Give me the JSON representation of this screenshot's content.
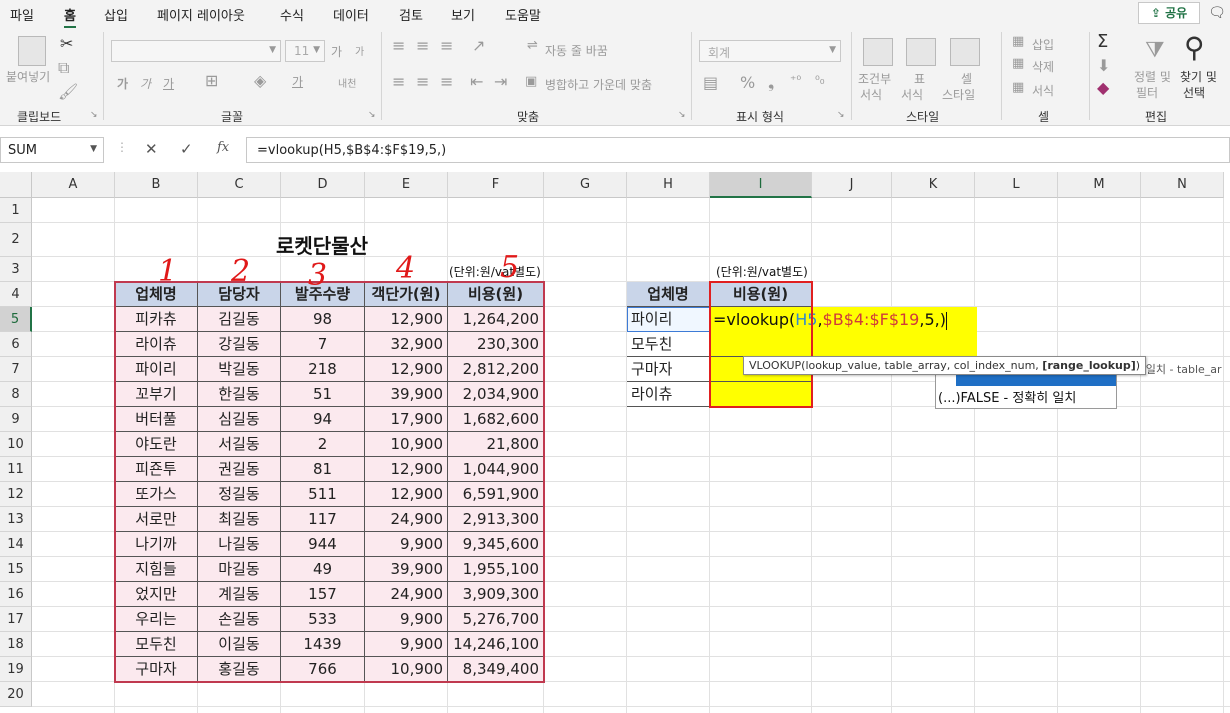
{
  "menu": {
    "items": [
      "파일",
      "홈",
      "삽입",
      "페이지 레이아웃",
      "수식",
      "데이터",
      "검토",
      "보기",
      "도움말"
    ],
    "share_label": "공유",
    "share_icon": "share-icon",
    "comment_icon": "comment-icon"
  },
  "ribbon": {
    "clipboard": {
      "paste": "붙여넣기",
      "label": "클립보드"
    },
    "font": {
      "size": "11",
      "label": "글꼴",
      "grow": "가",
      "shrink": "가"
    },
    "align": {
      "wrap": "자동 줄 바꿈",
      "merge": "병합하고 가운데 맞춤",
      "label": "맞춤"
    },
    "number": {
      "format": "회계",
      "label": "표시 형식"
    },
    "styles": {
      "conditional_1": "조건부",
      "conditional_2": "서식",
      "table_1": "표",
      "table_2": "서식",
      "cell_1": "셀",
      "cell_2": "스타일",
      "label": "스타일"
    },
    "cells": {
      "insert": "삽입",
      "delete": "삭제",
      "format": "서식",
      "label": "셀"
    },
    "edit": {
      "sort_1": "정렬 및",
      "sort_2": "필터",
      "find_1": "찾기 및",
      "find_2": "선택",
      "label": "편집"
    }
  },
  "formula_bar": {
    "name_box": "SUM",
    "formula": "=vlookup(H5,$B$4:$F$19,5,)",
    "cancel_icon": "cancel-icon",
    "enter_icon": "enter-icon",
    "fx": "fx"
  },
  "sheet": {
    "columns": [
      "A",
      "B",
      "C",
      "D",
      "E",
      "F",
      "G",
      "H",
      "I",
      "J",
      "K",
      "L",
      "M",
      "N"
    ],
    "rows": [
      "1",
      "2",
      "3",
      "4",
      "5",
      "6",
      "7",
      "8",
      "9",
      "10",
      "11",
      "12",
      "13",
      "14",
      "15",
      "16",
      "17",
      "18",
      "19",
      "20"
    ],
    "title": "로켓단물산",
    "unit_note_main": "(단위:원/vat별도)",
    "unit_note_side": "(단위:원/vat별도)",
    "handwritten": [
      "1",
      "2",
      "3",
      "4",
      "5"
    ],
    "main_table": {
      "headers": [
        "업체명",
        "담당자",
        "발주수량",
        "객단가(원)",
        "비용(원)"
      ],
      "rows": [
        [
          "피카츄",
          "김길동",
          "98",
          "12,900",
          "1,264,200"
        ],
        [
          "라이츄",
          "강길동",
          "7",
          "32,900",
          "230,300"
        ],
        [
          "파이리",
          "박길동",
          "218",
          "12,900",
          "2,812,200"
        ],
        [
          "꼬부기",
          "한길동",
          "51",
          "39,900",
          "2,034,900"
        ],
        [
          "버터풀",
          "심길동",
          "94",
          "17,900",
          "1,682,600"
        ],
        [
          "야도란",
          "서길동",
          "2",
          "10,900",
          "21,800"
        ],
        [
          "피죤투",
          "권길동",
          "81",
          "12,900",
          "1,044,900"
        ],
        [
          "또가스",
          "정길동",
          "511",
          "12,900",
          "6,591,900"
        ],
        [
          "서로만",
          "최길동",
          "117",
          "24,900",
          "2,913,300"
        ],
        [
          "나기까",
          "나길동",
          "944",
          "9,900",
          "9,345,600"
        ],
        [
          "지힘들",
          "마길동",
          "49",
          "39,900",
          "1,955,100"
        ],
        [
          "었지만",
          "계길동",
          "157",
          "24,900",
          "3,909,300"
        ],
        [
          "우리는",
          "손길동",
          "533",
          "9,900",
          "5,276,700"
        ],
        [
          "모두친",
          "이길동",
          "1439",
          "9,900",
          "14,246,100"
        ],
        [
          "구마자",
          "홍길동",
          "766",
          "10,900",
          "8,349,400"
        ]
      ]
    },
    "lookup_table": {
      "headers": [
        "업체명",
        "비용(원)"
      ],
      "names": [
        "파이리",
        "모두친",
        "구마자",
        "라이츄"
      ],
      "edit_prefix": "=vlookup(",
      "edit_ref1": "H5",
      "edit_comma1": ",",
      "edit_ref2": "$B$4:$F$19",
      "edit_rest": ",5,)"
    },
    "tooltip": {
      "prefix": "VLOOKUP(lookup_value, table_array, col_index_num, ",
      "bold": "[range_lookup]",
      "suffix": ")"
    },
    "autocomplete": {
      "item": "(...)FALSE - 정확히 일치",
      "behind": "유사 일치 - table_ar"
    }
  },
  "colors": {
    "accent": "#217346",
    "header_fill": "#c9d5e9",
    "row_fill": "#fbe9ee",
    "highlight": "#ffff00",
    "selection_border": "#e02020",
    "formula_ref1": "#2f8ad0",
    "formula_ref2": "#d03a3a"
  }
}
